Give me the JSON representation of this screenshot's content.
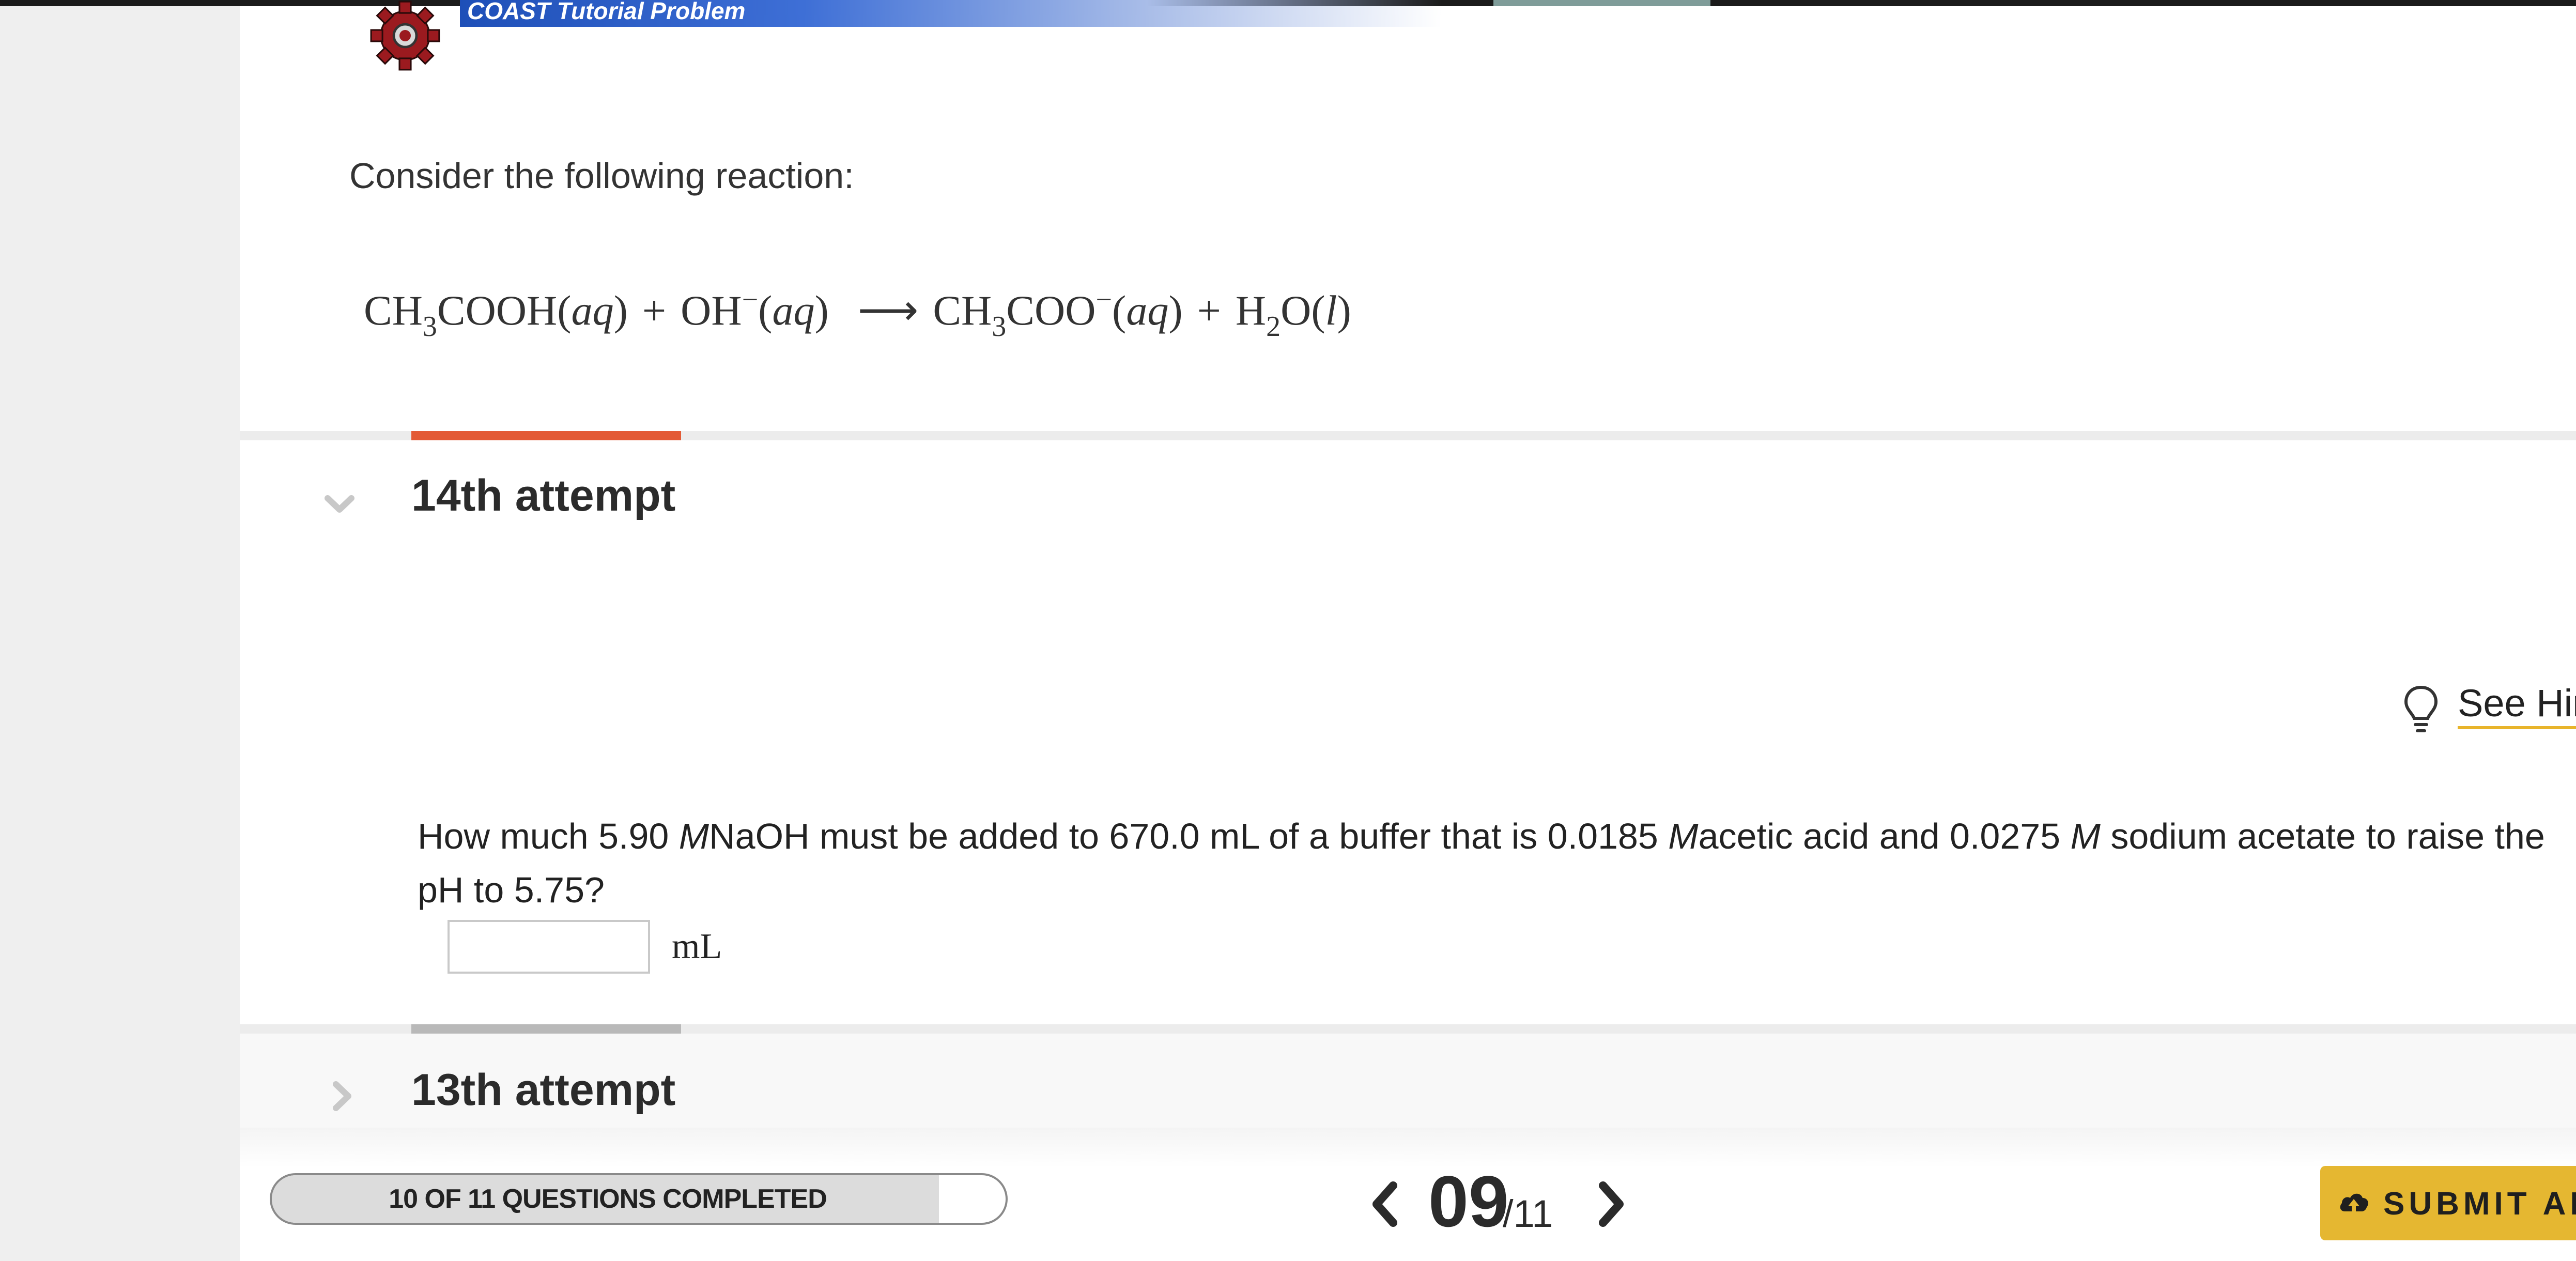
{
  "header": {
    "banner_label": "COAST Tutorial Problem"
  },
  "problem": {
    "intro": "Consider the following reaction:",
    "equation": {
      "r1_a": "CH",
      "r1_sub": "3",
      "r1_b": "COOH(",
      "r1_phase": "aq",
      "r1_c": ")",
      "plus1": "+",
      "r2_a": "OH",
      "r2_sup": "−",
      "r2_b": "(",
      "r2_phase": "aq",
      "r2_c": ")",
      "arrow": "⟶",
      "p1_a": "CH",
      "p1_sub": "3",
      "p1_b": "COO",
      "p1_sup": "−",
      "p1_c": "(",
      "p1_phase": "aq",
      "p1_d": ")",
      "plus2": "+",
      "p2_a": "H",
      "p2_sub": "2",
      "p2_b": "O(",
      "p2_phase": "l",
      "p2_c": ")"
    }
  },
  "attempt_current": {
    "title": "14th attempt",
    "hint_label": "See Hir",
    "question": {
      "part1": "How much 5.90 ",
      "unit_m1": "M",
      "part2": "NaOH must be added to 670.0 mL of a buffer that is 0.0185 ",
      "unit_m2": "M",
      "part3": "acetic acid and 0.0275 ",
      "unit_m3": "M",
      "part4": " sodium acetate to raise the pH to 5.75?"
    },
    "answer_value": "",
    "answer_unit": "mL"
  },
  "attempt_previous": {
    "title": "13th attempt"
  },
  "footer": {
    "progress_label": "10 OF 11 QUESTIONS COMPLETED",
    "progress_fraction": 0.909,
    "page_current": "09",
    "page_total": "/11",
    "submit_label": "SUBMIT AN"
  },
  "icons": {
    "gear": "gear-icon",
    "chevron_down": "chevron-down-icon",
    "chevron_right": "chevron-right-icon",
    "bulb": "lightbulb-icon",
    "prev": "chevron-left-icon",
    "next": "chevron-right-icon",
    "upload": "cloud-upload-icon"
  },
  "colors": {
    "accent_current_attempt": "#e35a35",
    "accent_previous_attempt": "#b9b9b9",
    "hint_underline": "#e8b42a",
    "submit_button": "#e5b731",
    "banner_blue": "#1e4fb8"
  }
}
